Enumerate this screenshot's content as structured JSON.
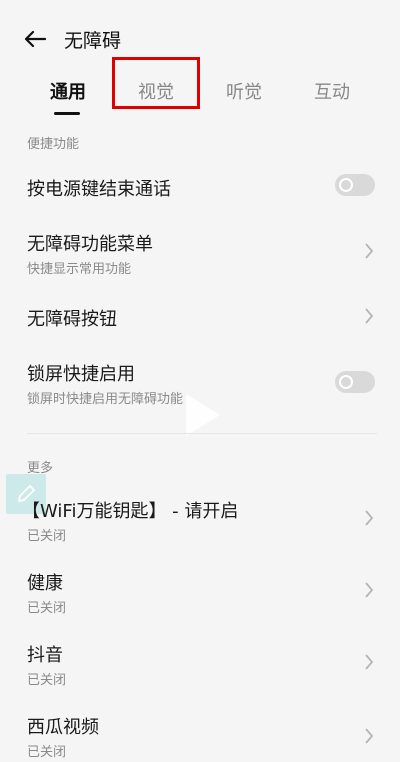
{
  "header": {
    "title": "无障碍",
    "back_icon": "back-arrow-icon"
  },
  "tabs": [
    {
      "label": "通用",
      "active": true
    },
    {
      "label": "视觉",
      "active": false
    },
    {
      "label": "听觉",
      "active": false
    },
    {
      "label": "互动",
      "active": false
    }
  ],
  "sections": {
    "shortcuts": {
      "label": "便捷功能",
      "items": [
        {
          "title": "按电源键结束通话",
          "toggle_on": false
        },
        {
          "title": "无障碍功能菜单",
          "subtitle": "快捷显示常用功能"
        },
        {
          "title": "无障碍按钮"
        },
        {
          "title": "锁屏快捷启用",
          "subtitle": "锁屏时快捷启用无障碍功能",
          "toggle_on": false
        }
      ]
    },
    "more": {
      "label": "更多",
      "items": [
        {
          "title": "【WiFi万能钥匙】 - 请开启",
          "subtitle": "已关闭"
        },
        {
          "title": "健康",
          "subtitle": "已关闭"
        },
        {
          "title": "抖音",
          "subtitle": "已关闭"
        },
        {
          "title": "西瓜视频",
          "subtitle": "已关闭"
        }
      ]
    }
  },
  "colors": {
    "highlight": "#e00000",
    "text_primary": "#1a1a1a",
    "text_secondary": "#8a8a8a"
  }
}
